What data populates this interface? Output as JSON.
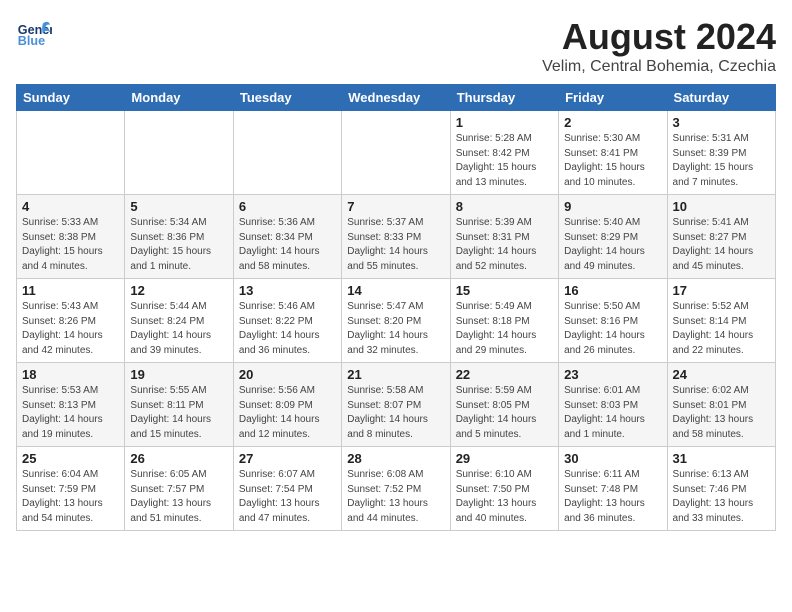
{
  "logo": {
    "line1": "General",
    "line2": "Blue"
  },
  "title": "August 2024",
  "subtitle": "Velim, Central Bohemia, Czechia",
  "days_of_week": [
    "Sunday",
    "Monday",
    "Tuesday",
    "Wednesday",
    "Thursday",
    "Friday",
    "Saturday"
  ],
  "weeks": [
    [
      {
        "day": "",
        "info": ""
      },
      {
        "day": "",
        "info": ""
      },
      {
        "day": "",
        "info": ""
      },
      {
        "day": "",
        "info": ""
      },
      {
        "day": "1",
        "info": "Sunrise: 5:28 AM\nSunset: 8:42 PM\nDaylight: 15 hours\nand 13 minutes."
      },
      {
        "day": "2",
        "info": "Sunrise: 5:30 AM\nSunset: 8:41 PM\nDaylight: 15 hours\nand 10 minutes."
      },
      {
        "day": "3",
        "info": "Sunrise: 5:31 AM\nSunset: 8:39 PM\nDaylight: 15 hours\nand 7 minutes."
      }
    ],
    [
      {
        "day": "4",
        "info": "Sunrise: 5:33 AM\nSunset: 8:38 PM\nDaylight: 15 hours\nand 4 minutes."
      },
      {
        "day": "5",
        "info": "Sunrise: 5:34 AM\nSunset: 8:36 PM\nDaylight: 15 hours\nand 1 minute."
      },
      {
        "day": "6",
        "info": "Sunrise: 5:36 AM\nSunset: 8:34 PM\nDaylight: 14 hours\nand 58 minutes."
      },
      {
        "day": "7",
        "info": "Sunrise: 5:37 AM\nSunset: 8:33 PM\nDaylight: 14 hours\nand 55 minutes."
      },
      {
        "day": "8",
        "info": "Sunrise: 5:39 AM\nSunset: 8:31 PM\nDaylight: 14 hours\nand 52 minutes."
      },
      {
        "day": "9",
        "info": "Sunrise: 5:40 AM\nSunset: 8:29 PM\nDaylight: 14 hours\nand 49 minutes."
      },
      {
        "day": "10",
        "info": "Sunrise: 5:41 AM\nSunset: 8:27 PM\nDaylight: 14 hours\nand 45 minutes."
      }
    ],
    [
      {
        "day": "11",
        "info": "Sunrise: 5:43 AM\nSunset: 8:26 PM\nDaylight: 14 hours\nand 42 minutes."
      },
      {
        "day": "12",
        "info": "Sunrise: 5:44 AM\nSunset: 8:24 PM\nDaylight: 14 hours\nand 39 minutes."
      },
      {
        "day": "13",
        "info": "Sunrise: 5:46 AM\nSunset: 8:22 PM\nDaylight: 14 hours\nand 36 minutes."
      },
      {
        "day": "14",
        "info": "Sunrise: 5:47 AM\nSunset: 8:20 PM\nDaylight: 14 hours\nand 32 minutes."
      },
      {
        "day": "15",
        "info": "Sunrise: 5:49 AM\nSunset: 8:18 PM\nDaylight: 14 hours\nand 29 minutes."
      },
      {
        "day": "16",
        "info": "Sunrise: 5:50 AM\nSunset: 8:16 PM\nDaylight: 14 hours\nand 26 minutes."
      },
      {
        "day": "17",
        "info": "Sunrise: 5:52 AM\nSunset: 8:14 PM\nDaylight: 14 hours\nand 22 minutes."
      }
    ],
    [
      {
        "day": "18",
        "info": "Sunrise: 5:53 AM\nSunset: 8:13 PM\nDaylight: 14 hours\nand 19 minutes."
      },
      {
        "day": "19",
        "info": "Sunrise: 5:55 AM\nSunset: 8:11 PM\nDaylight: 14 hours\nand 15 minutes."
      },
      {
        "day": "20",
        "info": "Sunrise: 5:56 AM\nSunset: 8:09 PM\nDaylight: 14 hours\nand 12 minutes."
      },
      {
        "day": "21",
        "info": "Sunrise: 5:58 AM\nSunset: 8:07 PM\nDaylight: 14 hours\nand 8 minutes."
      },
      {
        "day": "22",
        "info": "Sunrise: 5:59 AM\nSunset: 8:05 PM\nDaylight: 14 hours\nand 5 minutes."
      },
      {
        "day": "23",
        "info": "Sunrise: 6:01 AM\nSunset: 8:03 PM\nDaylight: 14 hours\nand 1 minute."
      },
      {
        "day": "24",
        "info": "Sunrise: 6:02 AM\nSunset: 8:01 PM\nDaylight: 13 hours\nand 58 minutes."
      }
    ],
    [
      {
        "day": "25",
        "info": "Sunrise: 6:04 AM\nSunset: 7:59 PM\nDaylight: 13 hours\nand 54 minutes."
      },
      {
        "day": "26",
        "info": "Sunrise: 6:05 AM\nSunset: 7:57 PM\nDaylight: 13 hours\nand 51 minutes."
      },
      {
        "day": "27",
        "info": "Sunrise: 6:07 AM\nSunset: 7:54 PM\nDaylight: 13 hours\nand 47 minutes."
      },
      {
        "day": "28",
        "info": "Sunrise: 6:08 AM\nSunset: 7:52 PM\nDaylight: 13 hours\nand 44 minutes."
      },
      {
        "day": "29",
        "info": "Sunrise: 6:10 AM\nSunset: 7:50 PM\nDaylight: 13 hours\nand 40 minutes."
      },
      {
        "day": "30",
        "info": "Sunrise: 6:11 AM\nSunset: 7:48 PM\nDaylight: 13 hours\nand 36 minutes."
      },
      {
        "day": "31",
        "info": "Sunrise: 6:13 AM\nSunset: 7:46 PM\nDaylight: 13 hours\nand 33 minutes."
      }
    ]
  ]
}
